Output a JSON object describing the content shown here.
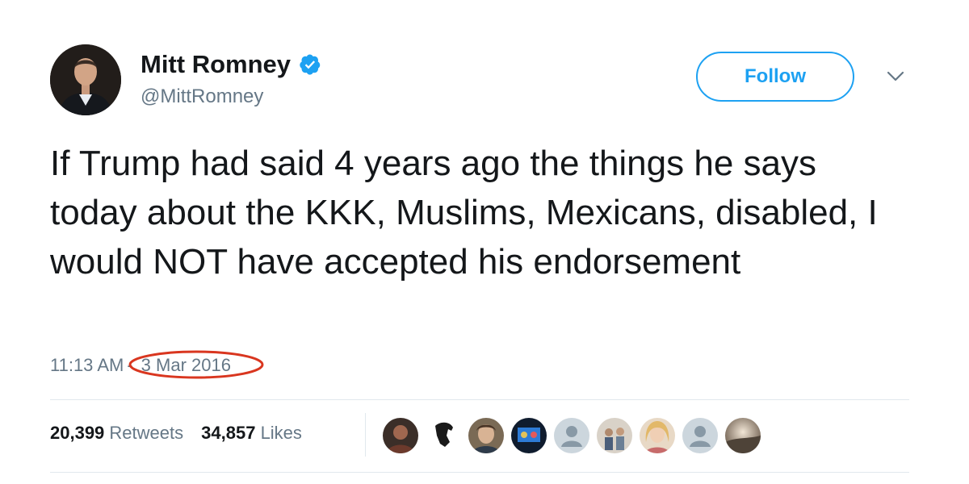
{
  "author": {
    "name": "Mitt Romney",
    "handle": "@MittRomney",
    "verified": true
  },
  "follow_button": {
    "label": "Follow"
  },
  "tweet": {
    "text": "If Trump had said 4 years ago the things he says today about the KKK, Muslims, Mexicans, disabled, I would NOT have accepted his endorsement",
    "time": "11:13 AM",
    "separator": "-",
    "date": "3 Mar 2016"
  },
  "stats": {
    "retweets_count": "20,399",
    "retweets_label": "Retweets",
    "likes_count": "34,857",
    "likes_label": "Likes"
  },
  "colors": {
    "accent": "#1da1f2",
    "secondary_text": "#657786",
    "annotation_circle": "#d9361f"
  },
  "icons": {
    "verified": "verified-badge-icon",
    "menu": "chevron-down-icon"
  }
}
